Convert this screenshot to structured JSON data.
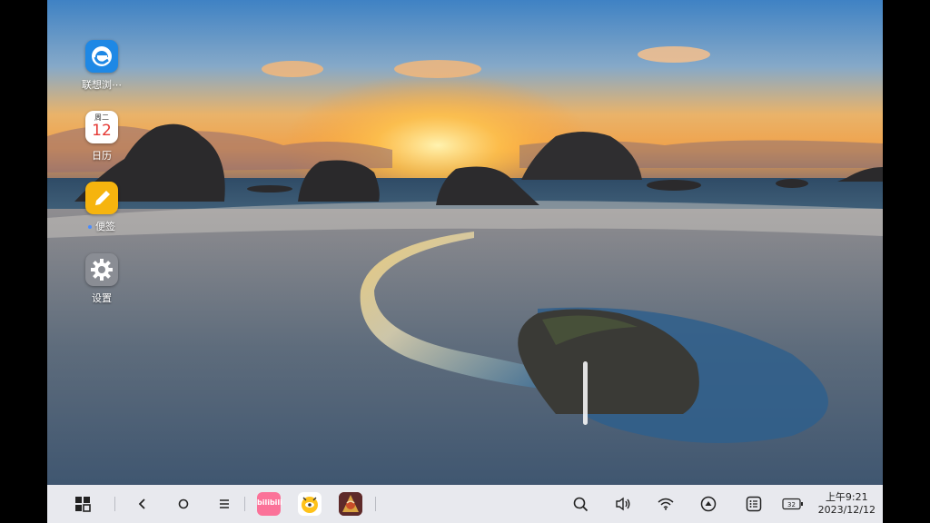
{
  "desktop": {
    "apps": [
      {
        "label": "联想浏⋯",
        "icon": "browser-icon"
      },
      {
        "label": "日历",
        "icon": "calendar-icon",
        "weekday": "周二",
        "day": "12"
      },
      {
        "label": "便签",
        "icon": "notes-icon",
        "indicator": true
      },
      {
        "label": "设置",
        "icon": "settings-icon"
      }
    ]
  },
  "taskbar": {
    "buttons": [
      "app-drawer-icon",
      "back-icon",
      "home-icon",
      "menu-icon"
    ],
    "dock_apps": [
      "bilibili-icon",
      "video-app-icon",
      "game-app-icon"
    ],
    "bilibili_label": "bilibili",
    "tray": [
      "search-icon",
      "volume-icon",
      "wifi-icon",
      "control-center-icon",
      "notifications-icon",
      "battery-icon"
    ],
    "battery_level": "32",
    "time": "上午9:21",
    "date": "2023/12/12"
  },
  "colors": {
    "taskbar_bg": "#e8e9ee",
    "browser_blue": "#1e88e5",
    "notes_yellow": "#f6b40e",
    "bilibili_pink": "#fb7299"
  }
}
